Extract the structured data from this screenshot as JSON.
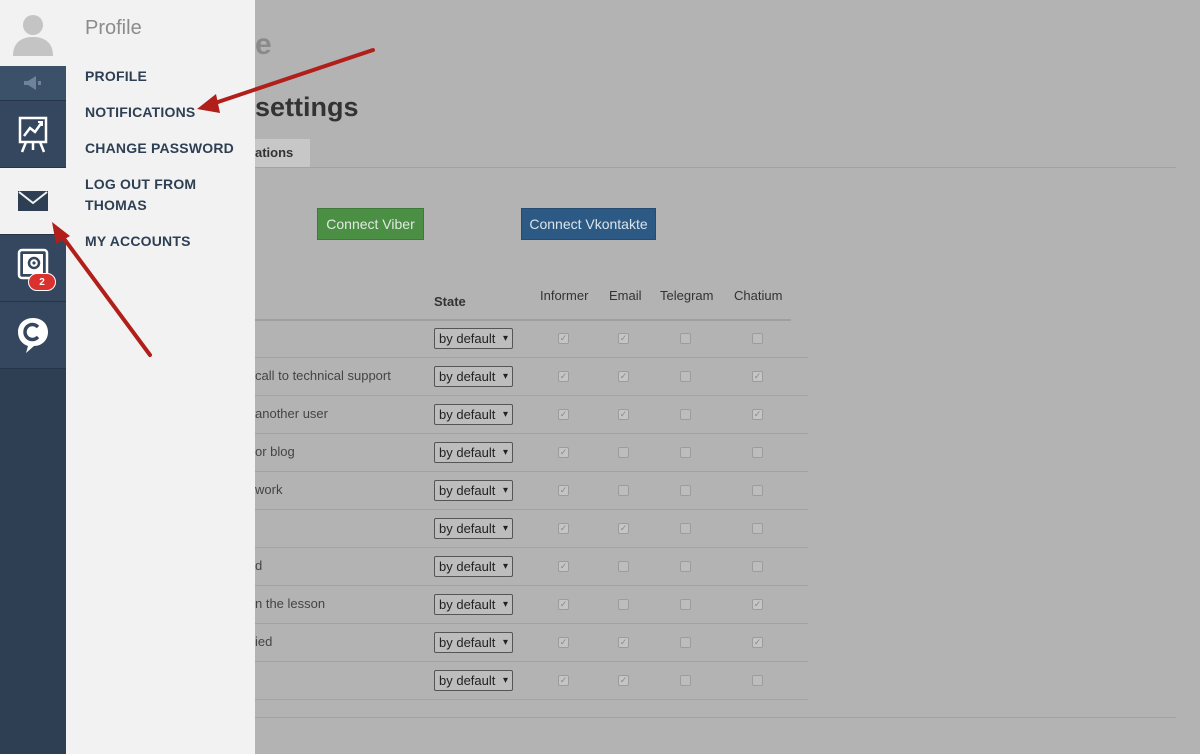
{
  "colors": {
    "sidebar": "#2e3f54",
    "panel": "#f2f2f2",
    "overlay": "#b3b3b3",
    "badge": "#d9312e",
    "viber": "#4b8f45",
    "vk": "#2d5a85",
    "arrow": "#b01f1a"
  },
  "sidebar": {
    "avatar_icon": "user-silhouette-icon",
    "items": [
      {
        "icon": "megaphone-icon"
      },
      {
        "icon": "chart-board-icon"
      },
      {
        "icon": "envelope-icon",
        "active": true
      },
      {
        "icon": "settings-monitor-icon",
        "badge": "2"
      },
      {
        "icon": "chatium-logo-icon"
      }
    ]
  },
  "panel": {
    "title": "Profile",
    "menu": [
      "PROFILE",
      "NOTIFICATIONS",
      "CHANGE PASSWORD",
      "LOG OUT FROM THOMAS",
      "MY ACCOUNTS"
    ]
  },
  "main": {
    "heading_partial": "e",
    "heading": "settings",
    "tab_label": "ations",
    "buttons": {
      "viber": "Connect Viber",
      "vk": "Connect Vkontakte"
    },
    "table": {
      "headers": {
        "state": "State",
        "informer": "Informer",
        "email": "Email",
        "telegram": "Telegram",
        "chatium": "Chatium"
      },
      "rows": [
        {
          "text": "",
          "state": "by default",
          "checks": [
            1,
            1,
            0,
            0
          ]
        },
        {
          "text": "call to technical support",
          "state": "by default",
          "checks": [
            1,
            1,
            0,
            1
          ]
        },
        {
          "text": "another user",
          "state": "by default",
          "checks": [
            1,
            1,
            0,
            1
          ]
        },
        {
          "text": "or blog",
          "state": "by default",
          "checks": [
            1,
            0,
            0,
            0
          ]
        },
        {
          "text": "work",
          "state": "by default",
          "checks": [
            1,
            0,
            0,
            0
          ]
        },
        {
          "text": "",
          "state": "by default",
          "checks": [
            1,
            1,
            0,
            0
          ]
        },
        {
          "text": "d",
          "state": "by default",
          "checks": [
            1,
            0,
            0,
            0
          ]
        },
        {
          "text": "n the lesson",
          "state": "by default",
          "checks": [
            1,
            0,
            0,
            1
          ]
        },
        {
          "text": "ied",
          "state": "by default",
          "checks": [
            1,
            1,
            0,
            1
          ]
        },
        {
          "text": "",
          "state": "by default",
          "checks": [
            1,
            1,
            0,
            0
          ]
        }
      ]
    }
  }
}
